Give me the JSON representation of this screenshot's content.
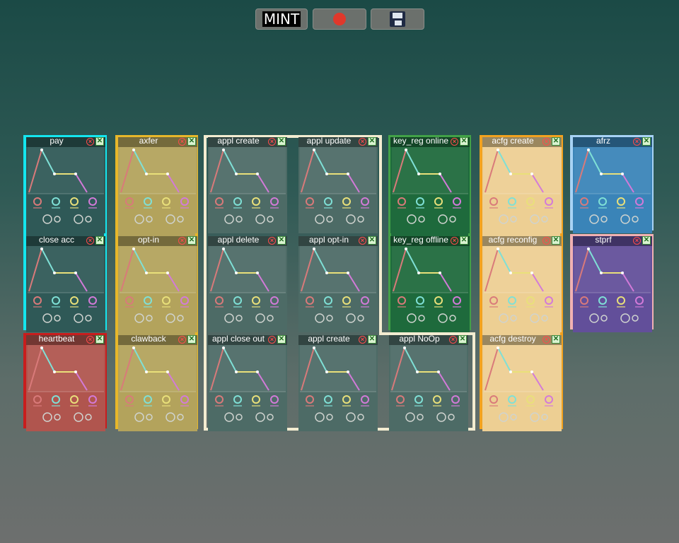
{
  "toolbar": {
    "mint_label": "MINT",
    "record_icon": "record-dot-icon",
    "save_icon": "floppy-disk-icon",
    "record_color": "#e0382b"
  },
  "groups": [
    {
      "name": "pay-group",
      "color": "#14e6ef",
      "fill": "#2f5957"
    },
    {
      "name": "heartbeat-group",
      "color": "#c81d1d",
      "fill": "#b0554e"
    },
    {
      "name": "axfer-group",
      "color": "#e7b72a",
      "fill": "#b3a35c"
    },
    {
      "name": "appl-group",
      "color": "#f3ecd1",
      "fill": "none"
    },
    {
      "name": "keyreg-group",
      "color": "#42a147",
      "fill": "#1e6a3c"
    },
    {
      "name": "acfg-group",
      "color": "#f2a21f",
      "fill": "#edcf93"
    },
    {
      "name": "afrz-group",
      "color": "#a8d3f5",
      "fill": "#3a84b8"
    },
    {
      "name": "stprf-group",
      "color": "#f1b1b3",
      "fill": "#624f9a"
    }
  ],
  "tiles": [
    {
      "title": "pay",
      "bg": "#2f5957"
    },
    {
      "title": "close acc",
      "bg": "#2f5957"
    },
    {
      "title": "heartbeat",
      "bg": "#b0554e"
    },
    {
      "title": "axfer",
      "bg": "#b3a35c"
    },
    {
      "title": "opt-in",
      "bg": "#b3a35c"
    },
    {
      "title": "clawback",
      "bg": "#b3a35c"
    },
    {
      "title": "appl create",
      "bg": "#4d6b66"
    },
    {
      "title": "appl update",
      "bg": "#4d6b66"
    },
    {
      "title": "appl delete",
      "bg": "#4d6b66"
    },
    {
      "title": "appl opt-in",
      "bg": "#4d6b66"
    },
    {
      "title": "appl close out",
      "bg": "#4d6b66"
    },
    {
      "title": "appl create",
      "bg": "#4d6b66"
    },
    {
      "title": "appl NoOp",
      "bg": "#4d6b66"
    },
    {
      "title": "key_reg online",
      "bg": "#1e6a3c"
    },
    {
      "title": "key_reg offline",
      "bg": "#1e6a3c"
    },
    {
      "title": "acfg create",
      "bg": "#edcf93"
    },
    {
      "title": "acfg reconfig",
      "bg": "#edcf93"
    },
    {
      "title": "acfg destroy",
      "bg": "#edcf93"
    },
    {
      "title": "afrz",
      "bg": "#3a84b8"
    },
    {
      "title": "stprf",
      "bg": "#624f9a"
    }
  ],
  "envelope_colors": {
    "attack": "#d97a7a",
    "decay": "#7fe0d6",
    "sustain": "#e9e07a",
    "release": "#d37ad9"
  },
  "tile_icons": {
    "remove": "remove-circle-icon",
    "close": "close-box-icon"
  }
}
